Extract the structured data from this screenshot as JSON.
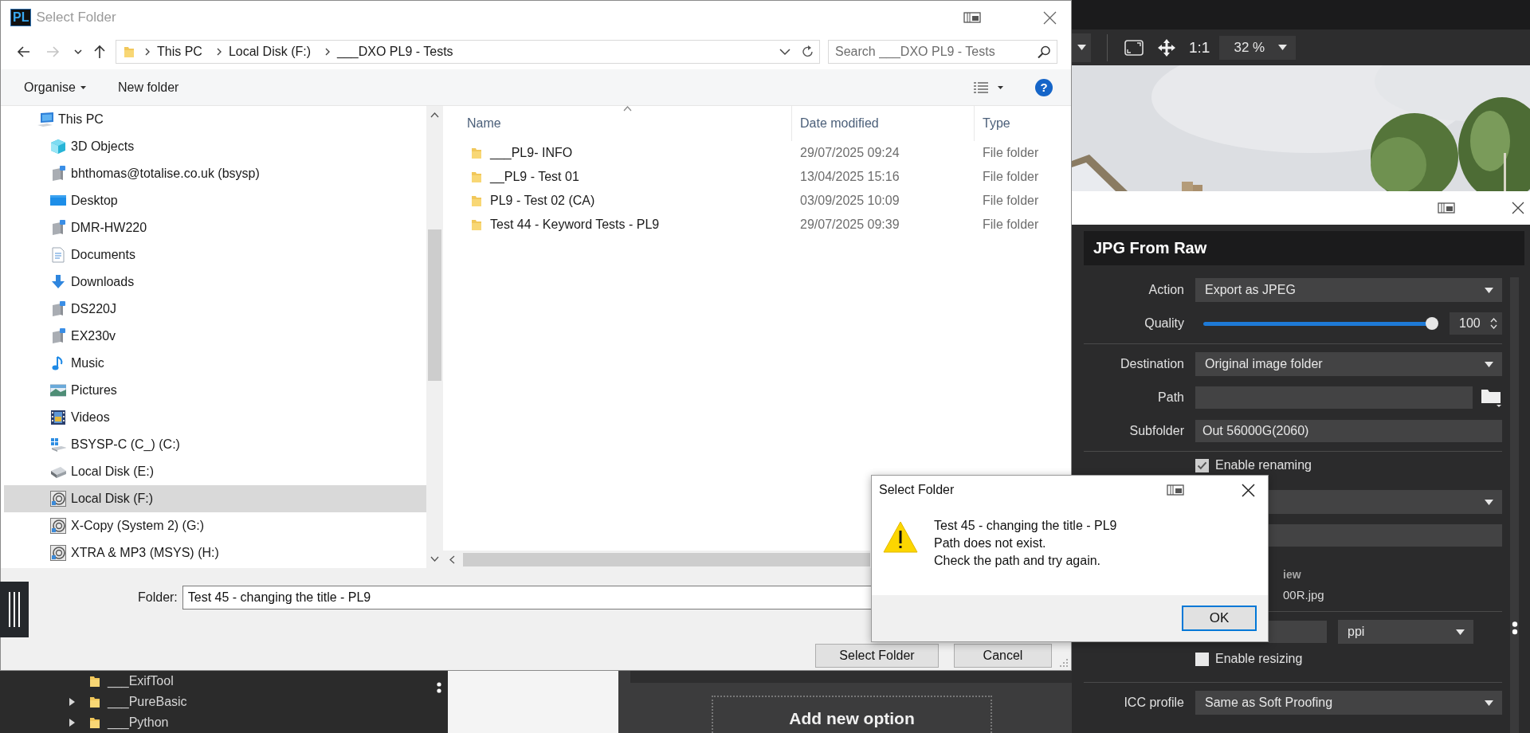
{
  "editor": {
    "zoom_ratio": "1:1",
    "zoom": "32 %",
    "tree": [
      {
        "label": "___ExifTool",
        "expandable": false
      },
      {
        "label": "___PureBasic",
        "expandable": true
      },
      {
        "label": "___Python",
        "expandable": true
      }
    ],
    "add_option": "Add new option"
  },
  "export_panel": {
    "title": "JPG From Raw",
    "rows": [
      {
        "kind": "dropdown",
        "label": "Action",
        "value": "Export as JPEG"
      },
      {
        "kind": "slider",
        "label": "Quality",
        "level": 1.0,
        "reading": "100"
      },
      {
        "kind": "separator"
      },
      {
        "kind": "dropdown",
        "label": "Destination",
        "value": "Original image folder"
      },
      {
        "kind": "path",
        "label": "Path"
      },
      {
        "kind": "field",
        "label": "Subfolder",
        "value": "Out 56000G(2060)"
      },
      {
        "kind": "separator"
      },
      {
        "kind": "checkbox",
        "label": "Enable renaming",
        "checked": true
      },
      {
        "kind": "dropdown"
      },
      {
        "kind": "field"
      },
      {
        "kind": "caption",
        "text": "iew"
      },
      {
        "kind": "text",
        "text": "00R.jpg"
      },
      {
        "kind": "separator"
      },
      {
        "kind": "size",
        "value": "ppi"
      },
      {
        "kind": "checkbox",
        "label": "Enable resizing",
        "checked": false
      },
      {
        "kind": "separator"
      },
      {
        "kind": "dropdown",
        "label": "ICC profile",
        "value": "Same as Soft Proofing"
      }
    ]
  },
  "file_dialog": {
    "logo": "PL",
    "title": "Select Folder",
    "nav_buttons": [
      {
        "kind": "back",
        "disabled": false
      },
      {
        "kind": "forward",
        "disabled": true
      },
      {
        "kind": "recent",
        "disabled": false
      },
      {
        "kind": "up",
        "disabled": false
      }
    ],
    "breadcrumb": [
      "This PC",
      "Local Disk (F:)",
      "___DXO PL9 - Tests"
    ],
    "search": {
      "placeholder": "Search ___DXO PL9 - Tests"
    },
    "commands": [
      {
        "label": "Organise",
        "menu": true
      },
      {
        "label": "New folder",
        "menu": false
      }
    ],
    "help": "?",
    "nav_tree": [
      {
        "label": "This PC",
        "kind": "computer",
        "selected": false,
        "children": [
          {
            "label": "3D Objects",
            "kind": "objects",
            "selected": false
          },
          {
            "label": "bhthomas@totalise.co.uk (bsysp)",
            "kind": "share",
            "selected": false
          },
          {
            "label": "Desktop",
            "kind": "desktop",
            "selected": false
          },
          {
            "label": "DMR-HW220",
            "kind": "share",
            "selected": false
          },
          {
            "label": "Documents",
            "kind": "documents",
            "selected": false
          },
          {
            "label": "Downloads",
            "kind": "downloads",
            "selected": false
          },
          {
            "label": "DS220J",
            "kind": "share",
            "selected": false
          },
          {
            "label": "EX230v",
            "kind": "share",
            "selected": false
          },
          {
            "label": "Music",
            "kind": "music",
            "selected": false
          },
          {
            "label": "Pictures",
            "kind": "pictures",
            "selected": false
          },
          {
            "label": "Videos",
            "kind": "videos",
            "selected": false
          },
          {
            "label": "BSYSP-C (C_) (C:)",
            "kind": "system",
            "selected": false
          },
          {
            "label": "Local Disk (E:)",
            "kind": "drive",
            "selected": false
          },
          {
            "label": "Local Disk (F:)",
            "kind": "disk",
            "selected": true
          },
          {
            "label": "X-Copy (System 2) (G:)",
            "kind": "disk",
            "selected": false
          },
          {
            "label": "XTRA & MP3 (MSYS) (H:)",
            "kind": "disk",
            "selected": false
          }
        ]
      }
    ],
    "columns": [
      "Name",
      "Date modified",
      "Type"
    ],
    "rows": [
      {
        "name": "___PL9- INFO",
        "date": "29/07/2025 09:24",
        "type": "File folder"
      },
      {
        "name": "__PL9 - Test 01",
        "date": "13/04/2025 15:16",
        "type": "File folder"
      },
      {
        "name": "PL9 - Test 02 (CA)",
        "date": "03/09/2025 10:09",
        "type": "File folder"
      },
      {
        "name": "Test 44 - Keyword Tests - PL9",
        "date": "29/07/2025 09:39",
        "type": "File folder"
      }
    ],
    "folder": {
      "label": "Folder:",
      "value": "Test 45 - changing the title - PL9"
    },
    "buttons": [
      "Select Folder",
      "Cancel"
    ]
  },
  "message_box": {
    "title": "Select Folder",
    "lines": [
      "Test 45 - changing the title - PL9",
      "Path does not exist.",
      "Check the path and try again."
    ],
    "button": "OK"
  }
}
